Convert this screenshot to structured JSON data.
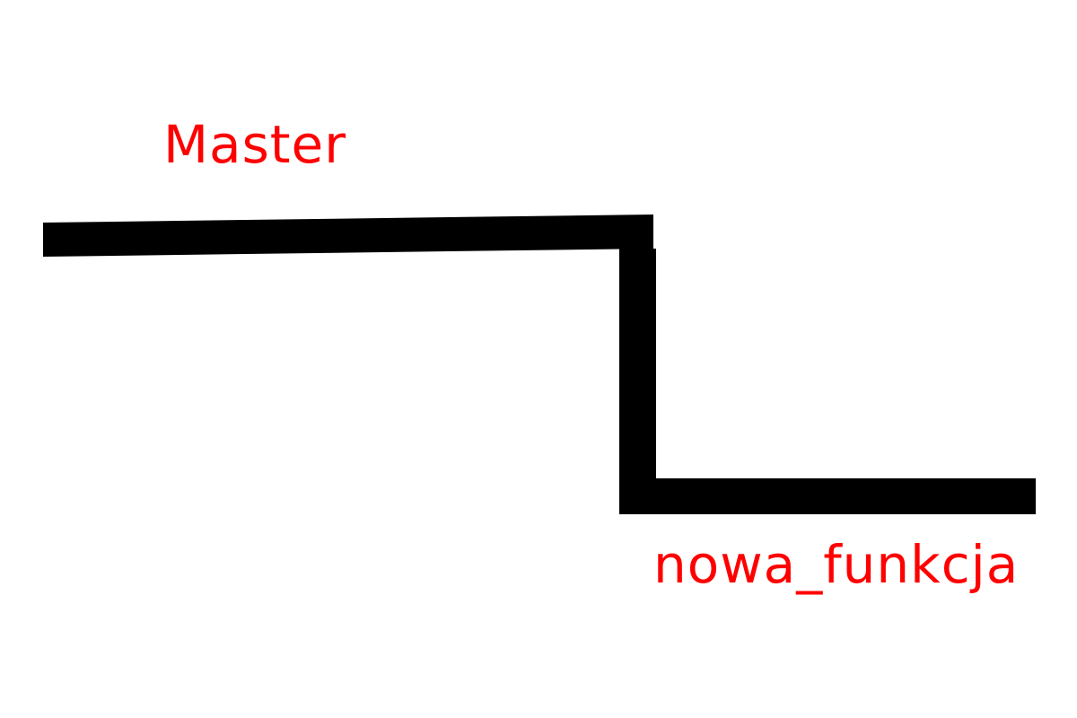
{
  "diagram": {
    "branches": [
      {
        "id": "master",
        "label": "Master"
      },
      {
        "id": "feature",
        "label": "nowa_funkcja"
      }
    ],
    "colors": {
      "line": "#000000",
      "label": "#ff0000",
      "background": "#ffffff"
    }
  }
}
